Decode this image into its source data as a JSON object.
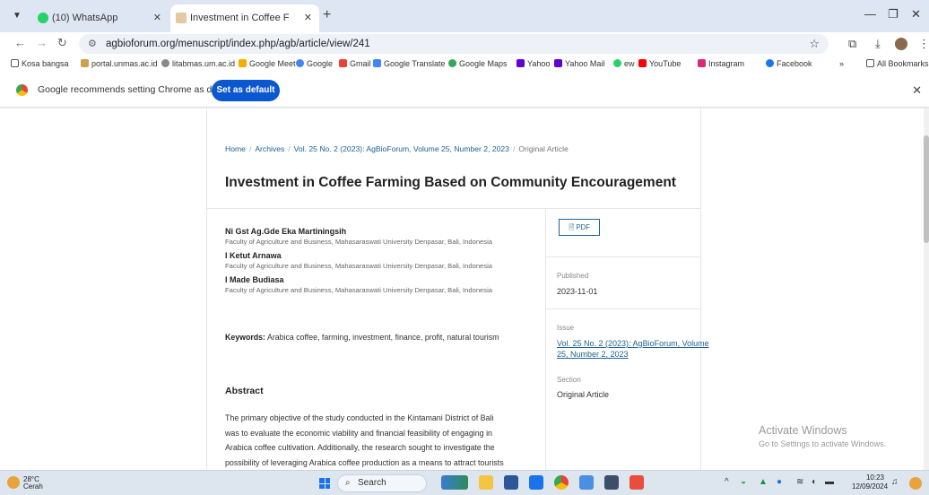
{
  "browser": {
    "tabs": [
      {
        "label": "(10) WhatsApp",
        "active": false
      },
      {
        "label": "Investment in Coffee Farming B",
        "active": true
      }
    ],
    "url": "agbioforum.org/menuscript/index.php/agb/article/view/241",
    "bookmarks": [
      "Kosa bangsa",
      "portal.unmas.ac.id",
      "litabmas.um.ac.id",
      "Google Meet",
      "Google",
      "Gmail",
      "Google Translate",
      "Google Maps",
      "Yahoo",
      "Yahoo Mail",
      "ew",
      "YouTube",
      "Instagram",
      "Facebook",
      "All Bookmarks"
    ],
    "bookmark_overflow": "»",
    "infobar": {
      "message": "Google recommends setting Chrome as default",
      "button": "Set as default"
    }
  },
  "article": {
    "breadcrumb": [
      "Home",
      "Archives",
      "Vol. 25 No. 2 (2023): AgBioForum, Volume 25, Number 2, 2023",
      "Original Article"
    ],
    "title": "Investment in Coffee Farming Based on Community Encouragement",
    "authors": [
      {
        "name": "Ni Gst Ag.Gde Eka Martiningsih",
        "affiliation": "Faculty of Agriculture and Business, Mahasaraswati University Denpasar, Bali, Indonesia"
      },
      {
        "name": "I Ketut Arnawa",
        "affiliation": "Faculty of Agriculture and Business, Mahasaraswati University Denpasar, Bali, Indonesia"
      },
      {
        "name": "I Made Budiasa",
        "affiliation": "Faculty of Agriculture and Business, Mahasaraswati University Denpasar, Bali, Indonesia"
      }
    ],
    "keywords_label": "Keywords:",
    "keywords": "Arabica coffee, farming, investment, finance, profit, natural tourism",
    "abstract_heading": "Abstract",
    "abstract_lines": [
      "The primary objective of the study conducted in the Kintamani District of Bali",
      "was to evaluate the economic viability and financial feasibility of engaging in",
      "Arabica coffee cultivation. Additionally, the research sought to investigate the",
      "possibility of leveraging Arabica coffee production as a means to attract tourists"
    ],
    "pdf_label": "PDF",
    "published_label": "Published",
    "published_date": "2023-11-01",
    "issue_label": "Issue",
    "issue_value": "Vol. 25 No. 2 (2023): AgBioForum, Volume 25, Number 2, 2023",
    "section_label": "Section",
    "section_value": "Original Article"
  },
  "watermark": {
    "line1": "Activate Windows",
    "line2": "Go to Settings to activate Windows."
  },
  "taskbar": {
    "temp": "28°C",
    "weather": "Cerah",
    "search": "Search",
    "time": "10:23",
    "date": "12/09/2024"
  }
}
